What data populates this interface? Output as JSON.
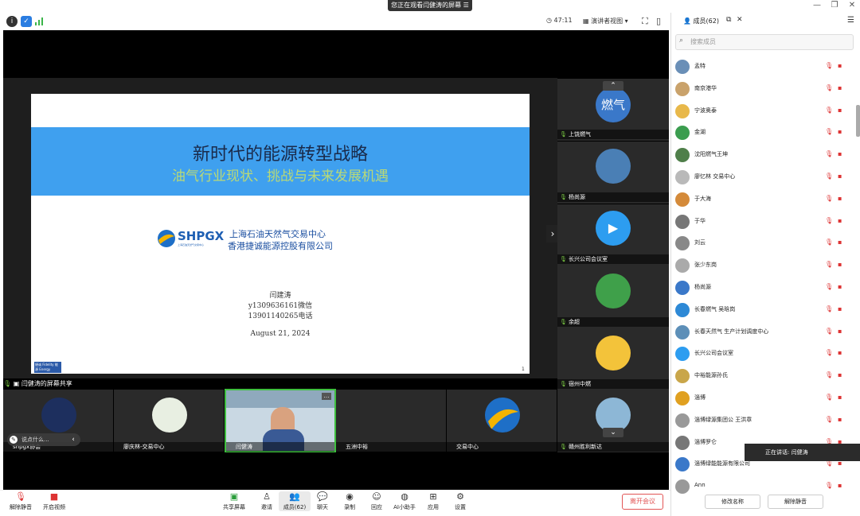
{
  "titlebar": {
    "banner": "您正在观看闫健涛的屏幕",
    "min": "—",
    "restore": "❐",
    "close": "✕"
  },
  "toolbar": {
    "timer": "47:11",
    "view_mode": "演讲者视图",
    "panel_title": "成员(62)"
  },
  "slide": {
    "title": "新时代的能源转型战略",
    "subtitle": "油气行业现状、挑战与未来发展机遇",
    "logo_text": "SHPGX",
    "logo_sub": "上海石油天然气交易中心",
    "org1": "上海石油天然气交易中心",
    "org2": "香港捷诚能源控股有限公司",
    "presenter": "闫建涛",
    "wechat": "y1309636161微信",
    "phone": "13901140265电话",
    "date": "August 21, 2024",
    "fidelity": "捷诚 Fidelity 能源 Energy",
    "page": "1",
    "band_color": "#3fa0ef"
  },
  "share_label": "闫健涛的屏幕共享",
  "right_thumbs": [
    {
      "name": "上饶燃气"
    },
    {
      "name": "杨尚源"
    },
    {
      "name": "长兴公司会议室"
    },
    {
      "name": "余超"
    },
    {
      "name": "宿州中燃"
    },
    {
      "name": "赣州胜利新达"
    }
  ],
  "bottom_thumbs": [
    {
      "name": "shpgx协会"
    },
    {
      "name": "廖庆林-交易中心"
    },
    {
      "name": "闫健涛"
    },
    {
      "name": "五洲中裕"
    },
    {
      "name": "交易中心"
    }
  ],
  "chat_pill": "说点什么...",
  "bottombar": [
    {
      "label": "解除静音",
      "icon": "mic-off-icon"
    },
    {
      "label": "开启视频",
      "icon": "camera-off-icon"
    },
    {
      "label": "共享屏幕",
      "icon": "share-screen-icon"
    },
    {
      "label": "邀请",
      "icon": "invite-icon"
    },
    {
      "label": "成员(62)",
      "icon": "members-icon"
    },
    {
      "label": "聊天",
      "icon": "chat-icon"
    },
    {
      "label": "录制",
      "icon": "record-icon"
    },
    {
      "label": "回应",
      "icon": "reaction-icon"
    },
    {
      "label": "AI小助手",
      "icon": "ai-icon"
    },
    {
      "label": "应用",
      "icon": "apps-icon"
    },
    {
      "label": "设置",
      "icon": "settings-icon"
    }
  ],
  "leave": "离开会议",
  "panel": {
    "search_placeholder": "搜索成员",
    "members": [
      "孟特",
      "南京港华",
      "宁波奥泰",
      "金湖",
      "沈阳燃气王坤",
      "廖忆林 交易中心",
      "于大海",
      "于华",
      "刘云",
      "张少东岗",
      "杨尚源",
      "长春燃气 吴晗岗",
      "长春天然气 生产计划调度中心",
      "长兴公司会议室",
      "中裕能源孙氏",
      "淄博",
      "淄博绿源集团公 王洪章",
      "淄博罗仑",
      "淄博绿能能源有限公司",
      "Ann"
    ],
    "speaking": "正在讲话: 闫健涛",
    "rename": "修改名称",
    "unmute": "解除静音"
  }
}
